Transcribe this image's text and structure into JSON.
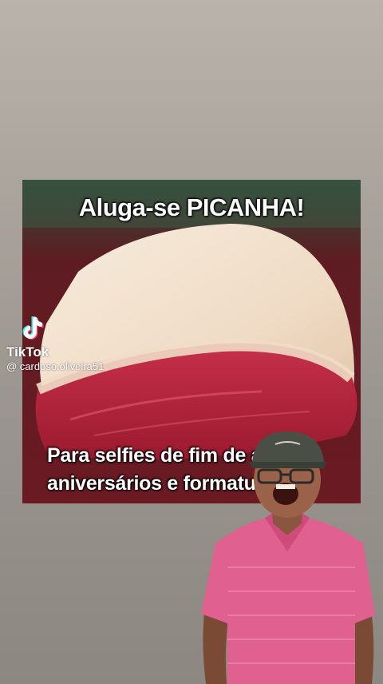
{
  "meme": {
    "top_caption": "Aluga-se PICANHA!",
    "bottom_caption_line1": "Para selfies de fim de ano,",
    "bottom_caption_line2": "aniversários e formaturas."
  },
  "watermark": {
    "brand": "TikTok",
    "username": "@ cardoso.oliveira51",
    "icon": "tiktok-logo-icon"
  },
  "colors": {
    "background": "#a9a39c",
    "meat_red": "#b5243a",
    "fat_cream": "#f3e2cf",
    "shirt_pink": "#e0608f",
    "cap_green": "#4a4f45"
  }
}
